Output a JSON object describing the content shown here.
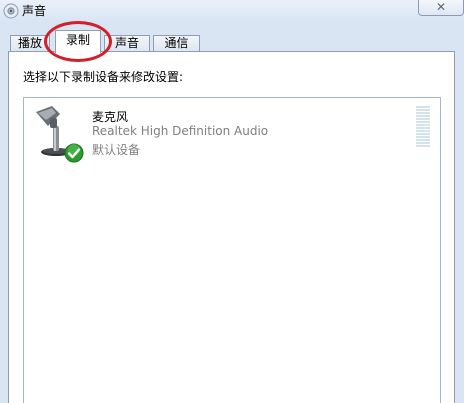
{
  "window": {
    "title": "声音",
    "close_label": "✕"
  },
  "tabs": [
    {
      "label": "播放"
    },
    {
      "label": "录制",
      "active": true
    },
    {
      "label": "声音"
    },
    {
      "label": "通信"
    }
  ],
  "recording": {
    "instruction": "选择以下录制设备来修改设置:",
    "devices": [
      {
        "name": "麦克风",
        "driver": "Realtek High Definition Audio",
        "status": "默认设备",
        "icon": "microphone-icon",
        "status_icon": "default-check-icon",
        "level": 0
      }
    ]
  },
  "colors": {
    "annotation_circle": "#d21f2a",
    "check_green": "#2e9a2e"
  }
}
